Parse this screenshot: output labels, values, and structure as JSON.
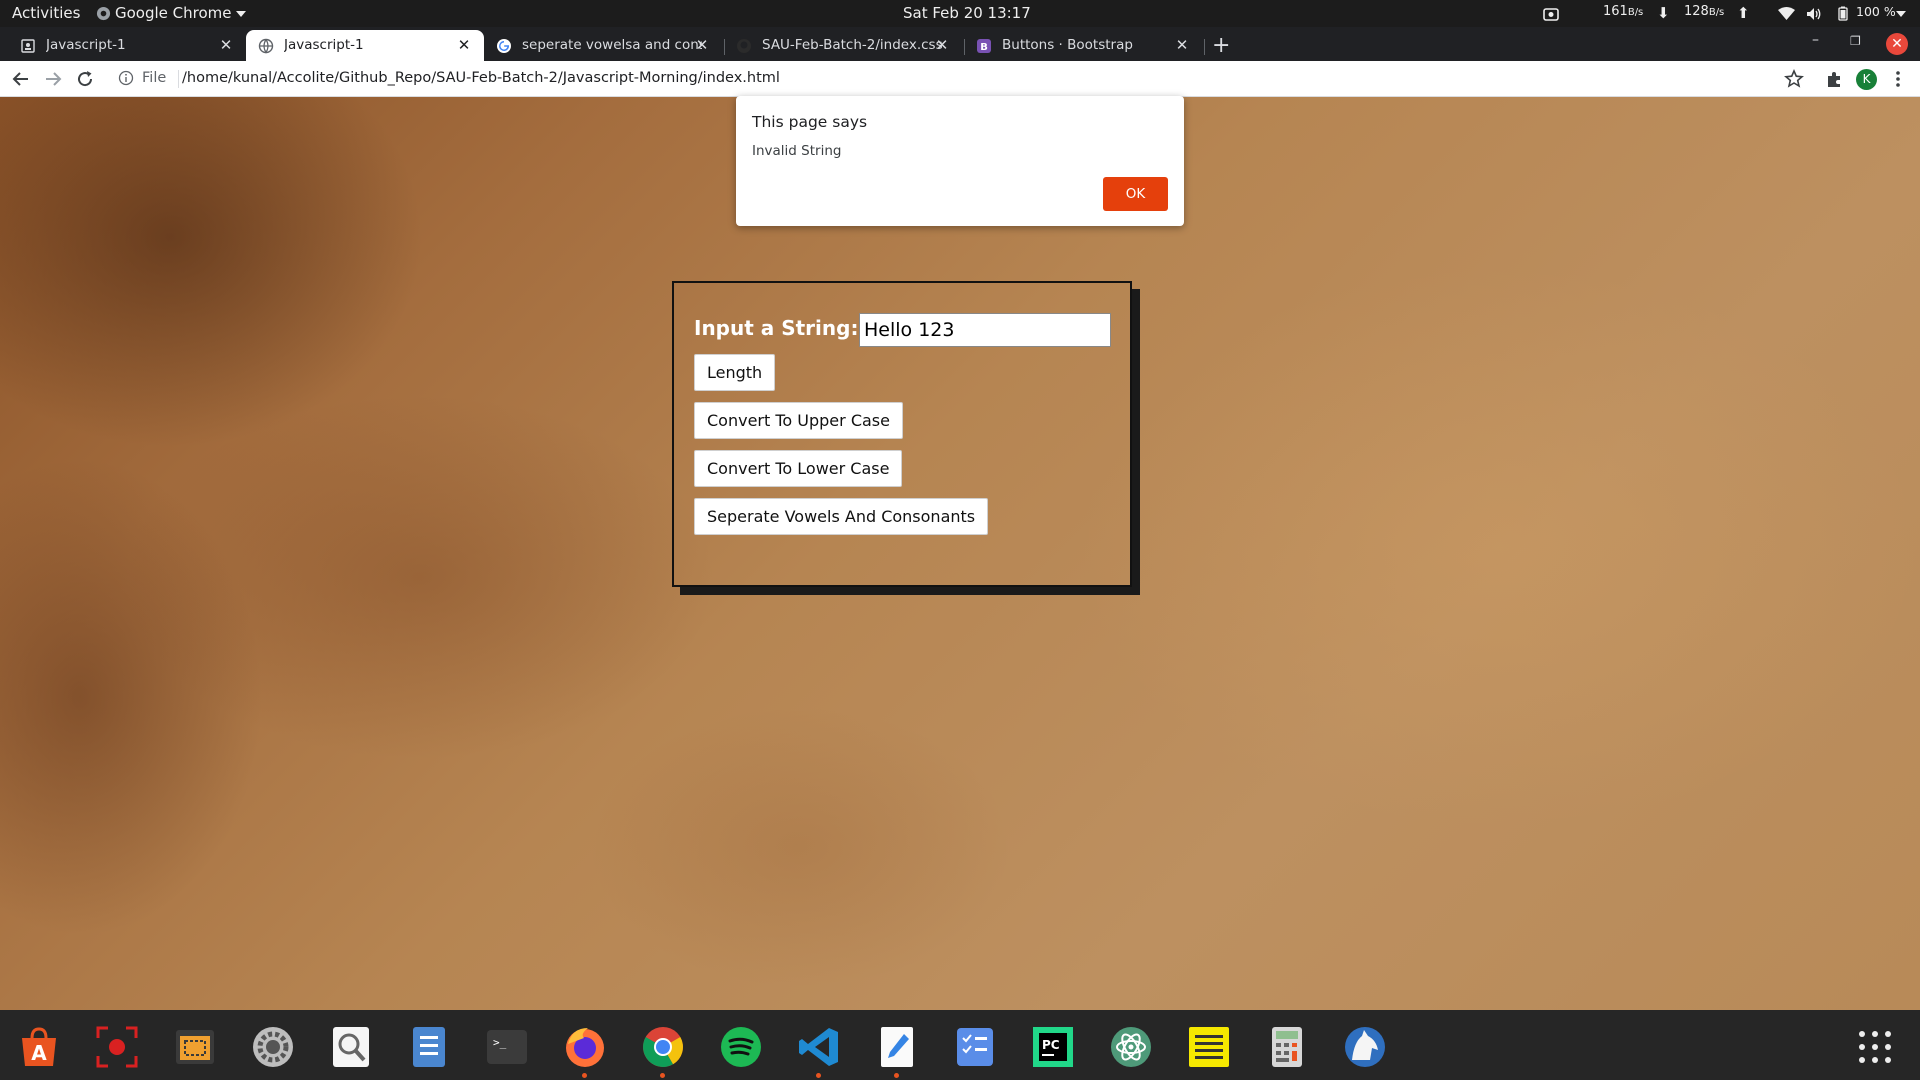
{
  "topbar": {
    "activities": "Activities",
    "app_name": "Google Chrome",
    "clock": "Sat Feb 20  13:17",
    "net_down_value": "161",
    "net_down_unit": "B/s",
    "net_up_value": "128",
    "net_up_unit": "B/s",
    "battery": "100 %"
  },
  "tabs": [
    {
      "title": "Javascript-1",
      "icon": "file-page-icon",
      "active": false
    },
    {
      "title": "Javascript-1",
      "icon": "globe-icon",
      "active": true
    },
    {
      "title": "seperate vowelsa and cons",
      "icon": "google-icon",
      "active": false
    },
    {
      "title": "SAU-Feb-Batch-2/index.css",
      "icon": "github-icon",
      "active": false
    },
    {
      "title": "Buttons · Bootstrap",
      "icon": "bootstrap-icon",
      "active": false
    }
  ],
  "omnibox": {
    "scheme_label": "File",
    "url": "/home/kunal/Accolite/Github_Repo/SAU-Feb-Batch-2/Javascript-Morning/index.html",
    "avatar_letter": "K"
  },
  "dialog": {
    "title": "This page says",
    "message": "Invalid String",
    "ok_label": "OK"
  },
  "form": {
    "label": "Input a String:",
    "input_value": "Hello 123",
    "buttons": {
      "length": "Length",
      "upper": "Convert To Upper Case",
      "lower": "Convert To Lower Case",
      "vowels": "Seperate Vowels And Consonants"
    }
  },
  "dock": [
    "ubuntu-software-icon",
    "screen-recorder-icon",
    "screenshot-icon",
    "settings-icon",
    "image-viewer-icon",
    "files-icon",
    "terminal-icon",
    "firefox-icon",
    "chrome-icon",
    "spotify-icon",
    "vscode-icon",
    "text-editor-icon",
    "tasks-icon",
    "pycharm-icon",
    "atom-icon",
    "notes-icon",
    "calculator-icon",
    "wolf-app-icon"
  ],
  "colors": {
    "dialog_ok": "#e5400c",
    "avatar": "#188038",
    "window_close": "#e9483b"
  }
}
